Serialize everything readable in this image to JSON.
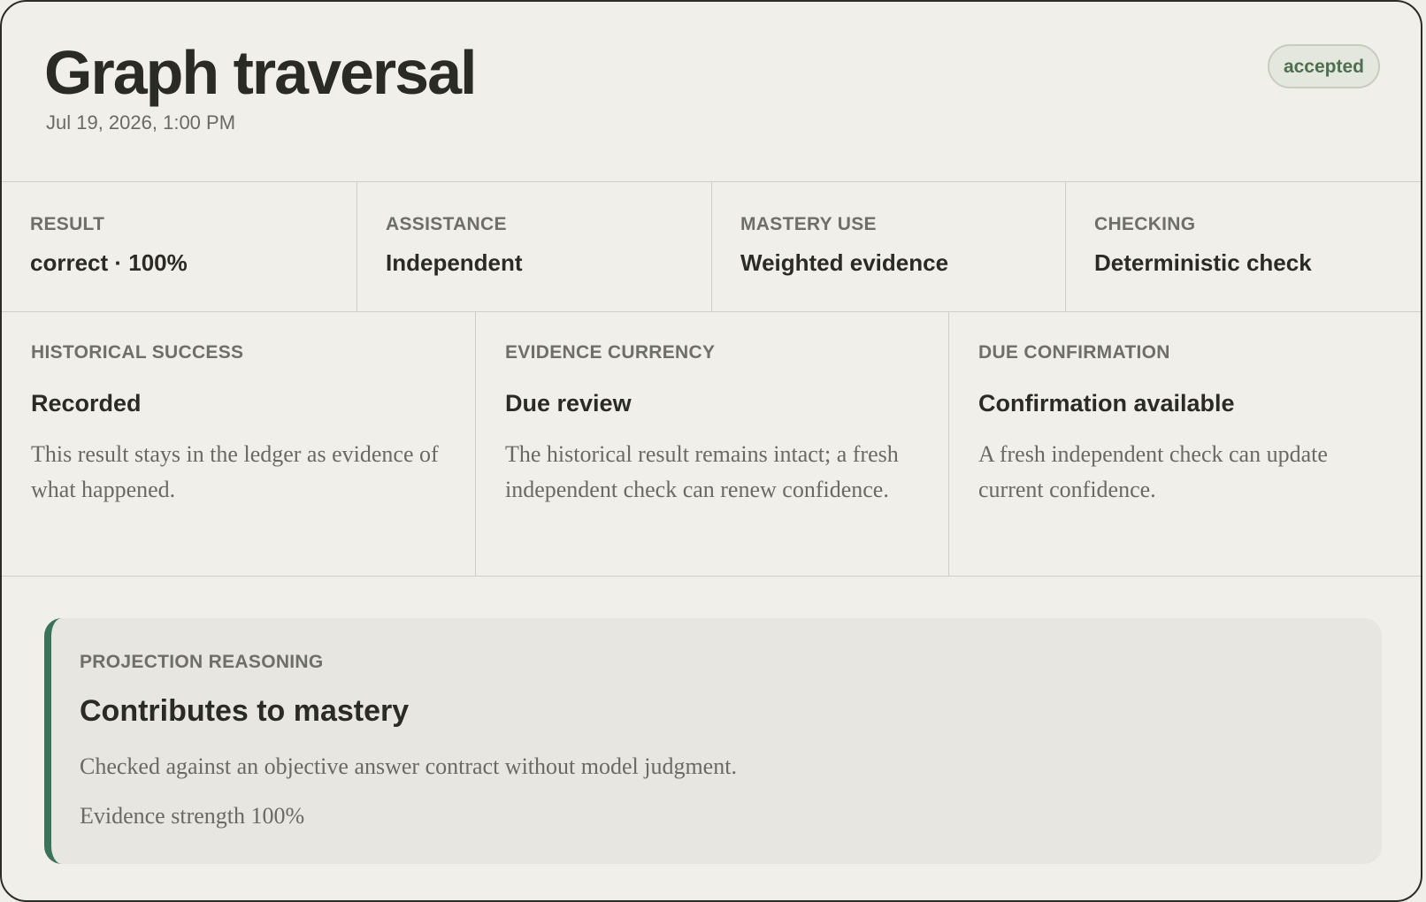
{
  "header": {
    "title": "Graph traversal",
    "timestamp": "Jul 19, 2026, 1:00 PM",
    "status_badge": "accepted"
  },
  "summary": [
    {
      "label": "RESULT",
      "value": "correct · 100%"
    },
    {
      "label": "ASSISTANCE",
      "value": "Independent"
    },
    {
      "label": "MASTERY USE",
      "value": "Weighted evidence"
    },
    {
      "label": "CHECKING",
      "value": "Deterministic check"
    }
  ],
  "details": [
    {
      "label": "HISTORICAL SUCCESS",
      "value": "Recorded",
      "description": "This result stays in the ledger as evidence of what happened."
    },
    {
      "label": "EVIDENCE CURRENCY",
      "value": "Due review",
      "description": "The historical result remains intact; a fresh independent check can renew confidence."
    },
    {
      "label": "DUE CONFIRMATION",
      "value": "Confirmation available",
      "description": "A fresh independent check can update current confidence."
    }
  ],
  "projection": {
    "label": "PROJECTION REASONING",
    "heading": "Contributes to mastery",
    "explanation": "Checked against an objective answer contract without model judgment.",
    "evidence_strength": "Evidence strength 100%"
  },
  "colors": {
    "background": "#f0efea",
    "accent_bar": "#3a7357",
    "badge_text": "#4e6e50",
    "badge_bg": "#e4e7dd"
  }
}
